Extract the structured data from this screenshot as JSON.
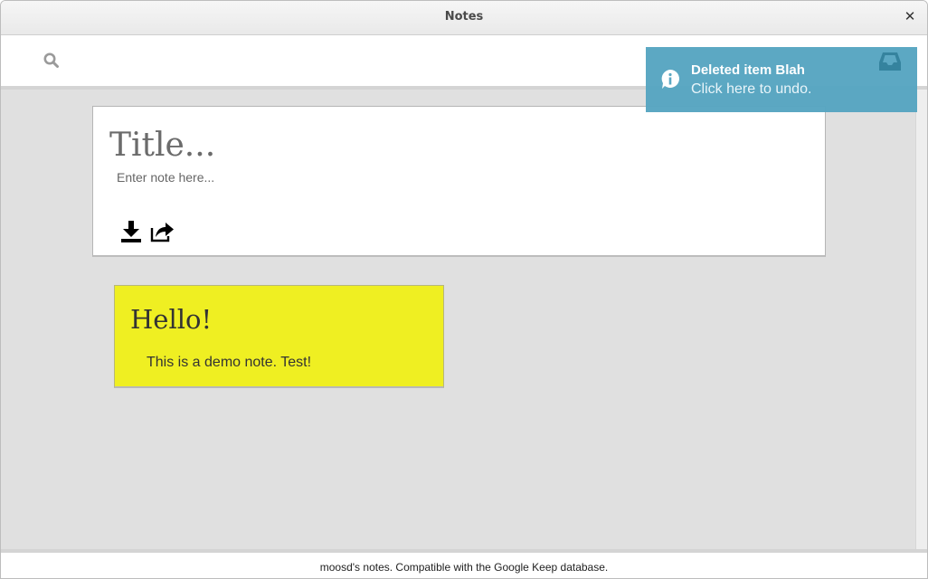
{
  "window": {
    "title": "Notes",
    "close_glyph": "✕"
  },
  "toolbar": {
    "search_icon": "search-icon"
  },
  "editor": {
    "title_placeholder": "Title...",
    "body_placeholder": "Enter note here...",
    "download_icon": "download-icon",
    "share_icon": "share-icon"
  },
  "notes": [
    {
      "title": "Hello!",
      "body": "This is a demo note. Test!",
      "color": "#efef22"
    }
  ],
  "notification": {
    "title": "Deleted item Blah",
    "message": "Click here to undo.",
    "icon": "info-icon",
    "action_icon": "inbox-icon",
    "color": "#57a6c2"
  },
  "status": {
    "text": "moosd's notes. Compatible with the Google Keep database."
  }
}
